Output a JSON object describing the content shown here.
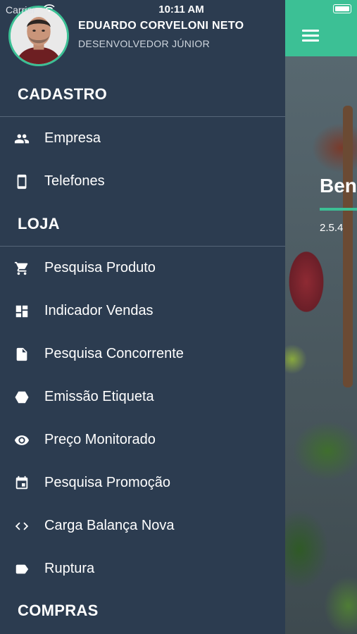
{
  "status_bar": {
    "carrier": "Carrier",
    "time": "10:11 AM"
  },
  "user": {
    "name": "EDUARDO CORVELONI NETO",
    "role": "DESENVOLVEDOR JÚNIOR"
  },
  "background_app": {
    "title": "Ben",
    "version": "2.5.4"
  },
  "sections": {
    "cadastro": "CADASTRO",
    "loja": "LOJA",
    "compras": "COMPRAS"
  },
  "menu": {
    "empresa": {
      "label": "Empresa",
      "icon": "people-icon"
    },
    "telefones": {
      "label": "Telefones",
      "icon": "phone-icon"
    },
    "pesquisa_produto": {
      "label": "Pesquisa Produto",
      "icon": "cart-icon"
    },
    "indicador_vendas": {
      "label": "Indicador Vendas",
      "icon": "dashboard-icon"
    },
    "pesquisa_concorrente": {
      "label": "Pesquisa Concorrente",
      "icon": "document-icon"
    },
    "emissao_etiqueta": {
      "label": "Emissão Etiqueta",
      "icon": "hexagon-icon"
    },
    "preco_monitorado": {
      "label": "Preço Monitorado",
      "icon": "eye-icon"
    },
    "pesquisa_promocao": {
      "label": "Pesquisa Promoção",
      "icon": "calendar-icon"
    },
    "carga_balanca_nova": {
      "label": "Carga Balança Nova",
      "icon": "code-icon"
    },
    "ruptura": {
      "label": "Ruptura",
      "icon": "label-icon"
    }
  },
  "colors": {
    "drawer_bg": "#2c3c50",
    "accent": "#3cc095",
    "divider": "#566678"
  }
}
